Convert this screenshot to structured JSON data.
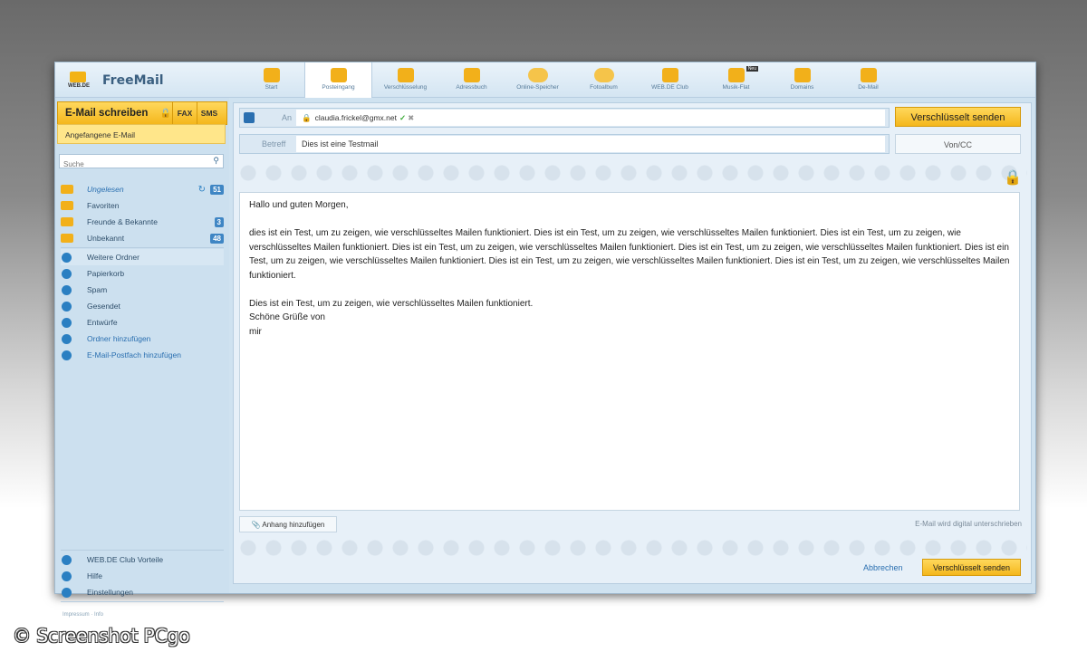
{
  "app": {
    "brand_small": "WEB.DE",
    "title": "FreeMail"
  },
  "nav": [
    {
      "label": "Start"
    },
    {
      "label": "Posteingang",
      "active": true
    },
    {
      "label": "Verschlüsselung"
    },
    {
      "label": "Adressbuch"
    },
    {
      "label": "Online-Speicher"
    },
    {
      "label": "Fotoalbum"
    },
    {
      "label": "WEB.DE Club"
    },
    {
      "label": "Musik-Flat",
      "badge": "Neu"
    },
    {
      "label": "Domains"
    },
    {
      "label": "De-Mail"
    }
  ],
  "sidebar": {
    "compose_label": "E-Mail schreiben",
    "fax_label": "FAX",
    "sms_label": "SMS",
    "draft_label": "Angefangene E-Mail",
    "search_placeholder": "Suche",
    "folders": [
      {
        "name": "Ungelesen",
        "count": "51",
        "style": "italic-link"
      },
      {
        "name": "Favoriten"
      },
      {
        "name": "Freunde & Bekannte",
        "count": "3"
      },
      {
        "name": "Unbekannt",
        "count": "48"
      },
      {
        "name": "Weitere Ordner",
        "highlight": true
      },
      {
        "name": "Papierkorb"
      },
      {
        "name": "Spam"
      },
      {
        "name": "Gesendet"
      },
      {
        "name": "Entwürfe"
      },
      {
        "name": "Ordner hinzufügen"
      },
      {
        "name": "E-Mail-Postfach hinzufügen"
      }
    ],
    "bottom": [
      {
        "name": "WEB.DE Club Vorteile"
      },
      {
        "name": "Hilfe"
      },
      {
        "name": "Einstellungen"
      }
    ],
    "footer": "Impressum · Info"
  },
  "compose": {
    "to_label": "An",
    "to_value": "claudia.frickel@gmx.net",
    "send_encrypted_label": "Verschlüsselt senden",
    "subject_label": "Betreff",
    "subject_value": "Dies ist eine Testmail",
    "voncc_label": "Von/CC",
    "body": {
      "greeting": "Hallo und guten Morgen,",
      "paragraph": "dies ist ein Test, um zu zeigen, wie verschlüsseltes Mailen funktioniert. Dies ist ein Test, um zu zeigen, wie verschlüsseltes Mailen funktioniert. Dies ist ein Test, um zu zeigen, wie verschlüsseltes Mailen funktioniert. Dies ist ein Test, um zu zeigen, wie verschlüsseltes Mailen funktioniert. Dies ist ein Test, um zu zeigen, wie verschlüsseltes Mailen funktioniert. Dies ist ein Test, um zu zeigen, wie verschlüsseltes Mailen funktioniert. Dies ist ein Test, um zu zeigen, wie verschlüsseltes Mailen funktioniert. Dies ist ein Test, um zu zeigen, wie verschlüsseltes Mailen funktioniert.",
      "line1": "Dies ist ein Test, um zu zeigen, wie verschlüsseltes Mailen funktioniert.",
      "line2": "Schöne Grüße von",
      "line3": "mir"
    },
    "attach_label": "Anhang hinzufügen",
    "signed_note": "E-Mail wird digital unterschrieben",
    "cancel_label": "Abbrechen",
    "send_bottom_label": "Verschlüsselt senden"
  },
  "watermark": "© Screenshot PCgo"
}
